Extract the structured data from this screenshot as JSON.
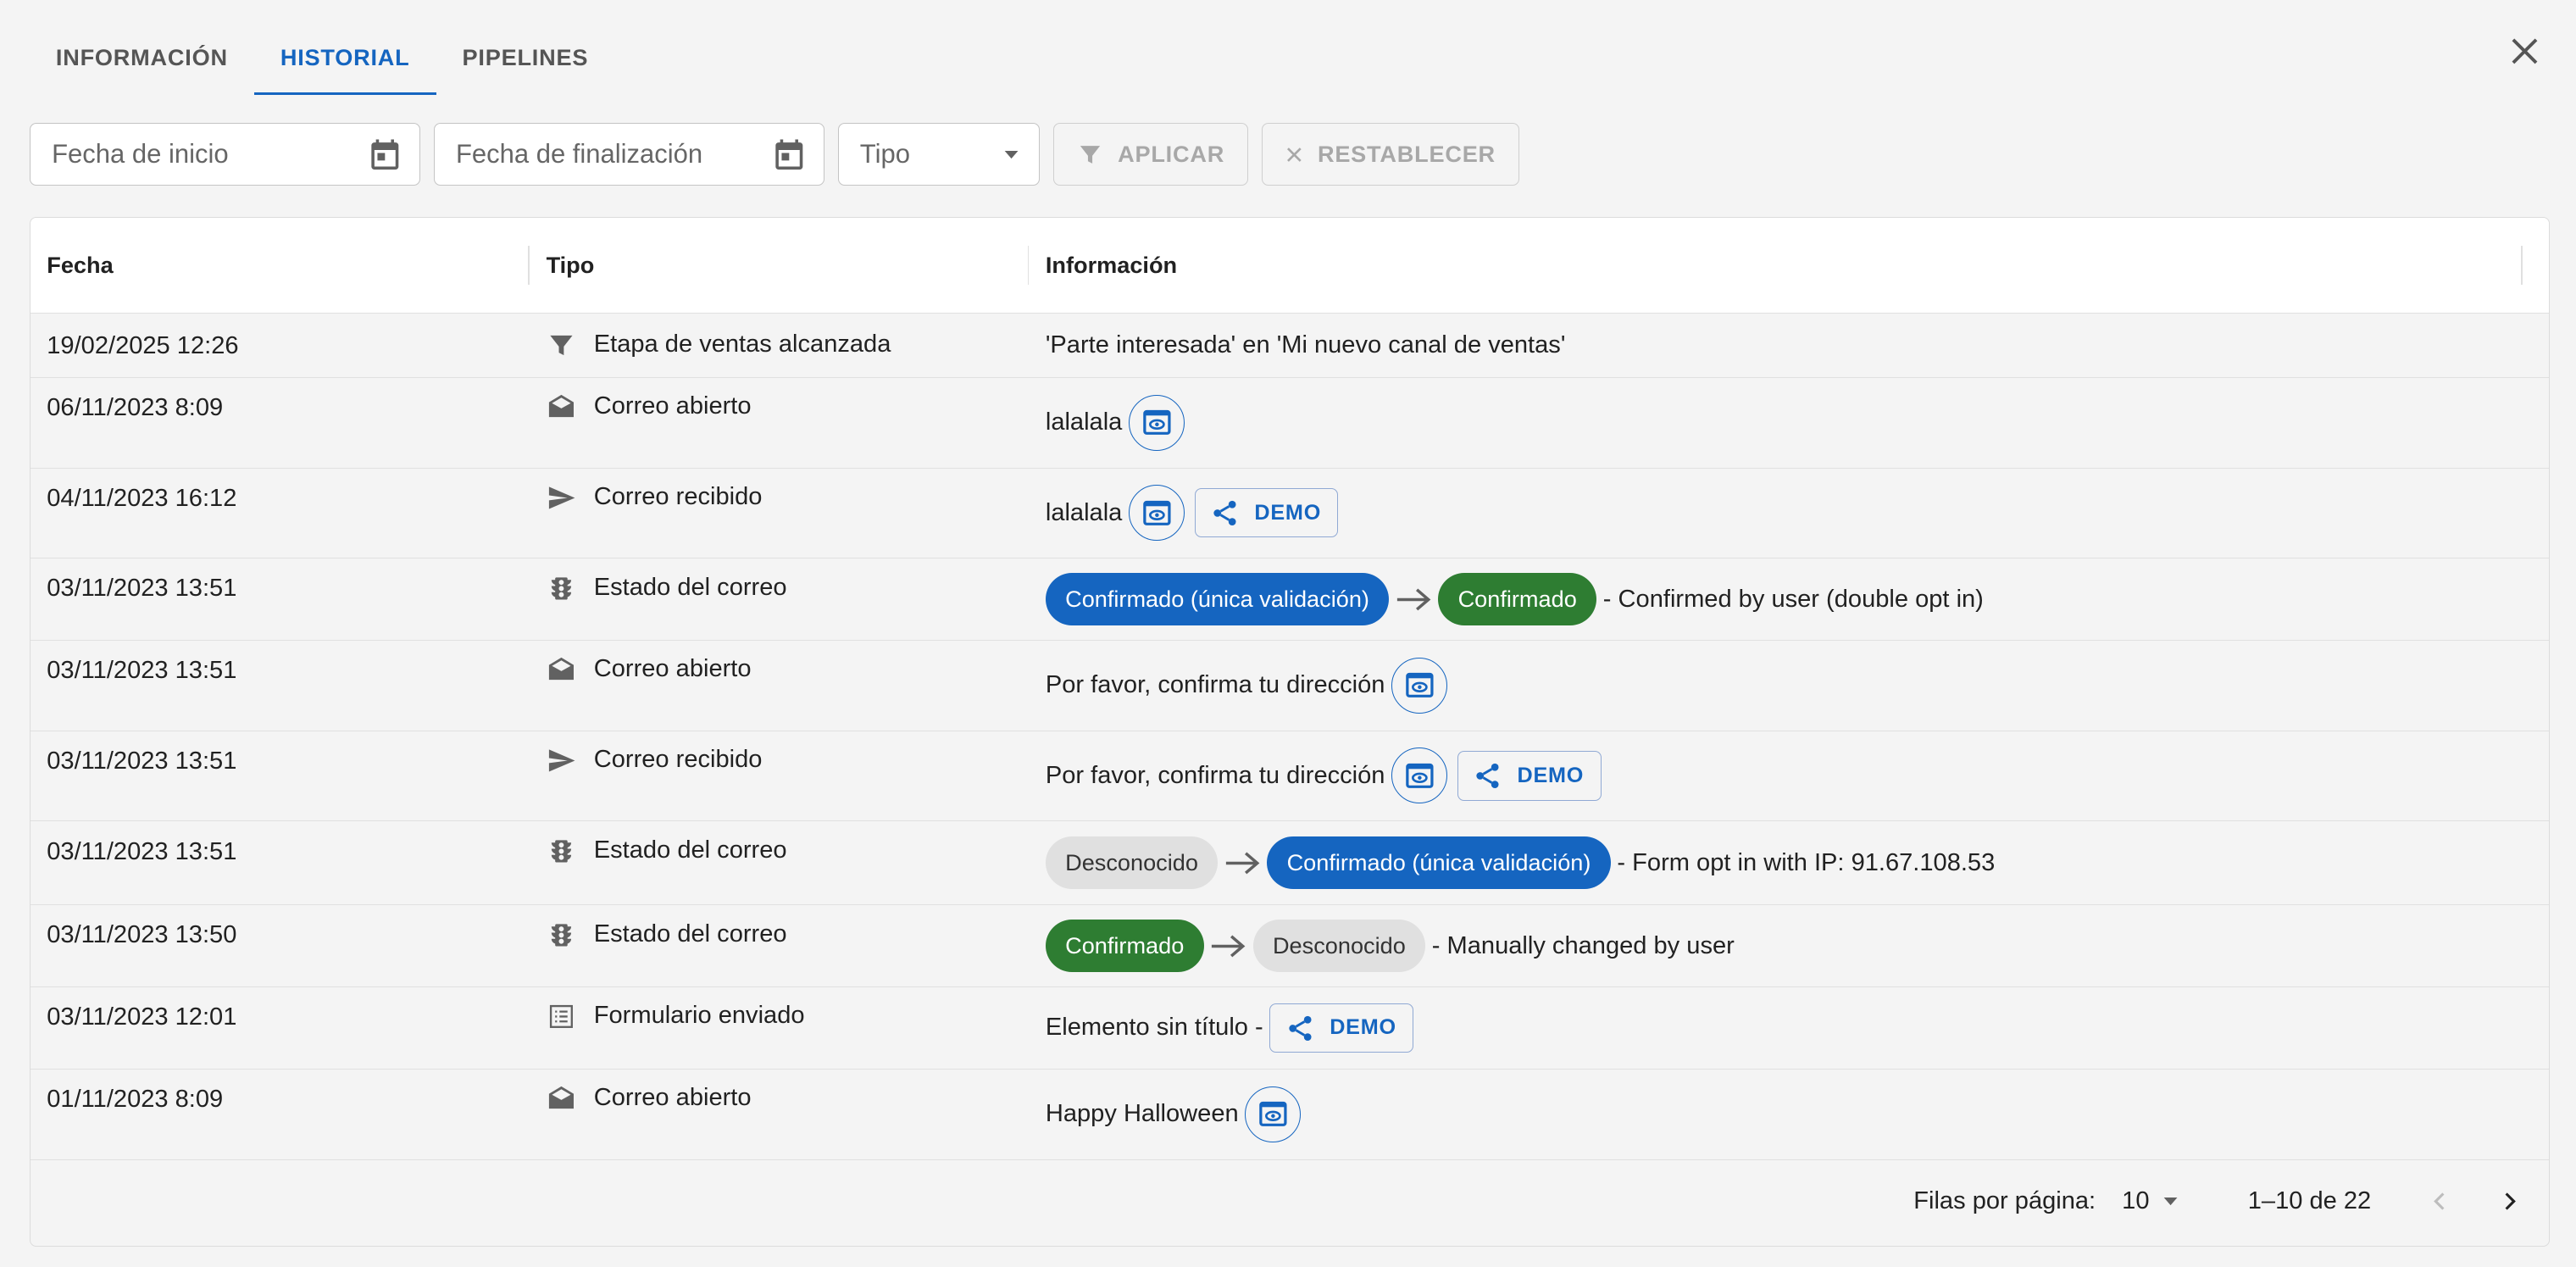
{
  "tabs": [
    {
      "label": "INFORMACIÓN",
      "active": false
    },
    {
      "label": "HISTORIAL",
      "active": true
    },
    {
      "label": "PIPELINES",
      "active": false
    }
  ],
  "filters": {
    "start_date_placeholder": "Fecha de inicio",
    "end_date_placeholder": "Fecha de finalización",
    "type_placeholder": "Tipo",
    "apply_label": "APLICAR",
    "reset_label": "RESTABLECER"
  },
  "table": {
    "columns": [
      "Fecha",
      "Tipo",
      "Información"
    ],
    "rows": [
      {
        "date": "19/02/2025 12:26",
        "type": "Etapa de ventas alcanzada",
        "icon": "funnel-icon",
        "info": "'Parte interesada' en 'Mi nuevo canal de ventas'"
      },
      {
        "date": "06/11/2023 8:09",
        "type": "Correo abierto",
        "icon": "open-envelope-icon",
        "info": "lalalala"
      },
      {
        "date": "04/11/2023 16:12",
        "type": "Correo recibido",
        "icon": "send-icon",
        "info": "lalalala",
        "demo": "DEMO"
      },
      {
        "date": "03/11/2023 13:51",
        "type": "Estado del correo",
        "icon": "traffic-light-icon",
        "from": "Confirmado (única validación)",
        "to": "Confirmado",
        "suffix": "- Confirmed by user (double opt in)"
      },
      {
        "date": "03/11/2023 13:51",
        "type": "Correo abierto",
        "icon": "open-envelope-icon",
        "info": "Por favor, confirma tu dirección"
      },
      {
        "date": "03/11/2023 13:51",
        "type": "Correo recibido",
        "icon": "send-icon",
        "info": "Por favor, confirma tu dirección",
        "demo": "DEMO"
      },
      {
        "date": "03/11/2023 13:51",
        "type": "Estado del correo",
        "icon": "traffic-light-icon",
        "from": "Desconocido",
        "to": "Confirmado (única validación)",
        "suffix": "- Form opt in with IP: 91.67.108.53"
      },
      {
        "date": "03/11/2023 13:50",
        "type": "Estado del correo",
        "icon": "traffic-light-icon",
        "from": "Confirmado",
        "to": "Desconocido",
        "suffix": "- Manually changed by user"
      },
      {
        "date": "03/11/2023 12:01",
        "type": "Formulario enviado",
        "icon": "form-list-icon",
        "info": "Elemento sin título -",
        "demo": "DEMO"
      },
      {
        "date": "01/11/2023 8:09",
        "type": "Correo abierto",
        "icon": "open-envelope-icon",
        "info": "Happy Halloween"
      }
    ]
  },
  "pagination": {
    "rows_per_page_label": "Filas por página:",
    "rows_per_page": "10",
    "range": "1–10 de 22"
  },
  "colors": {
    "accent": "#1565c0",
    "confirmed_green": "#2e7d32",
    "unknown_grey": "#e0e0e0"
  }
}
